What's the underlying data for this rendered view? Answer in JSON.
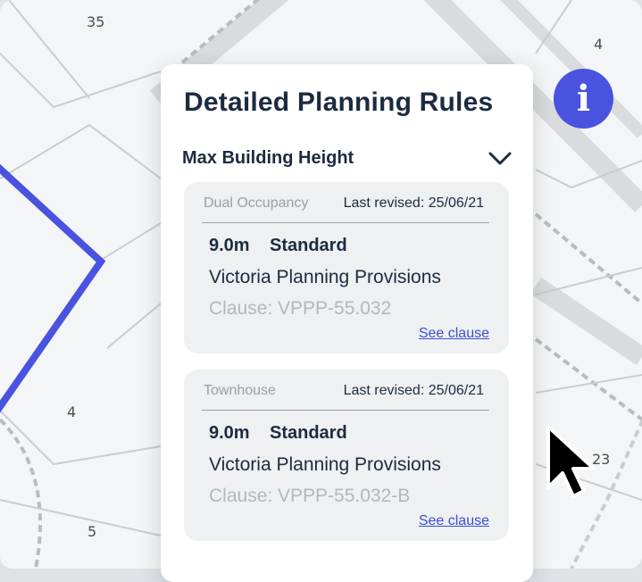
{
  "map": {
    "parcel_labels": [
      "35",
      "4",
      "4",
      "5",
      "23"
    ]
  },
  "panel": {
    "title": "Detailed Planning Rules",
    "section": {
      "title": "Max Building Height",
      "toggle_icon": "chevron-down-icon"
    },
    "cards": [
      {
        "type": "Dual Occupancy",
        "revised": "Last revised: 25/06/21",
        "height": "9.0m",
        "standard": "Standard",
        "provisions": "Victoria Planning Provisions",
        "clause": "Clause: VPPP-55.032",
        "link": "See clause"
      },
      {
        "type": "Townhouse",
        "revised": "Last revised: 25/06/21",
        "height": "9.0m",
        "standard": "Standard",
        "provisions": "Victoria Planning Provisions",
        "clause": "Clause: VPPP-55.032-B",
        "link": "See clause"
      }
    ]
  },
  "info_button": {
    "label": "i",
    "icon": "info-icon",
    "color": "#4a52e0"
  },
  "colors": {
    "accent": "#4a52e0",
    "title": "#1c2b40",
    "link": "#3d4ed6",
    "parcel_boundary": "#4a52e0"
  }
}
